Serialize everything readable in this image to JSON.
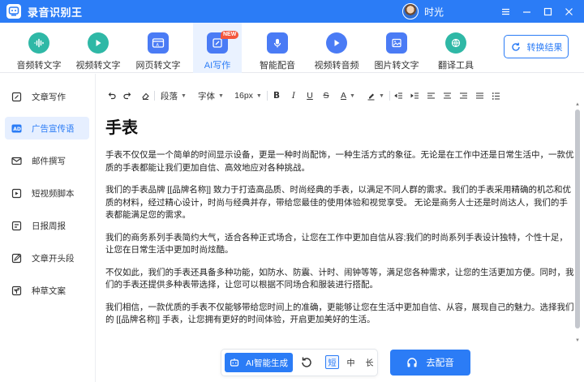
{
  "app": {
    "title": "录音识别王",
    "username": "时光"
  },
  "tools": [
    {
      "label": "音频转文字",
      "icon": "audio-wave-icon",
      "color": "#2fb8a6"
    },
    {
      "label": "视频转文字",
      "icon": "video-play-icon",
      "color": "#2fb8a6"
    },
    {
      "label": "网页转文字",
      "icon": "webpage-icon",
      "color": "#4a7bf5"
    },
    {
      "label": "AI写作",
      "icon": "ai-write-icon",
      "color": "#4a7bf5",
      "badge": "NEW"
    },
    {
      "label": "智能配音",
      "icon": "microphone-icon",
      "color": "#4a7bf5"
    },
    {
      "label": "视频转音频",
      "icon": "video-to-audio-icon",
      "color": "#4a7bf5"
    },
    {
      "label": "图片转文字",
      "icon": "image-text-icon",
      "color": "#4a7bf5"
    },
    {
      "label": "翻译工具",
      "icon": "translate-icon",
      "color": "#2fb8a6"
    }
  ],
  "convert_button": "转换结果",
  "sidebar": {
    "items": [
      {
        "label": "文章写作",
        "icon": "pen-square-icon"
      },
      {
        "label": "广告宣传语",
        "icon": "ad-icon"
      },
      {
        "label": "邮件撰写",
        "icon": "mail-icon"
      },
      {
        "label": "短视频脚本",
        "icon": "video-script-icon"
      },
      {
        "label": "日报周报",
        "icon": "report-icon"
      },
      {
        "label": "文章开头段",
        "icon": "edit-icon"
      },
      {
        "label": "种草文案",
        "icon": "sprout-icon"
      }
    ],
    "active_index": 1
  },
  "format_bar": {
    "paragraph": "段落",
    "font": "字体",
    "size": "16px"
  },
  "document": {
    "title": "手表",
    "paragraphs": [
      "手表不仅仅是一个简单的时间显示设备，更是一种时尚配饰，一种生活方式的象征。无论是在工作中还是日常生活中，一款优质的手表都能让我们更加自信、高效地应对各种挑战。",
      "我们的手表品牌 [[品牌名称]] 致力于打造高品质、时尚经典的手表，以满足不同人群的需求。我们的手表采用精确的机芯和优质的材料，经过精心设计，时尚与经典并存，带给您最佳的使用体验和视觉享受。 无论是商务人士还是时尚达人，我们的手表都能满足您的需求。",
      "我们的商务系列手表简约大气，适合各种正式场合，让您在工作中更加自信从容;我们的时尚系列手表设计独特，个性十足，让您在日常生活中更加时尚炫酷。",
      "不仅如此，我们的手表还具备多种功能，如防水、防震、计时、闹钟等等，满足您各种需求，让您的生活更加方便。同时，我们的手表还提供多种表带选择，让您可以根据不同场合和服装进行搭配。",
      "我们相信，一款优质的手表不仅能够带给您时间上的准确，更能够让您在生活中更加自信、从容，展现自己的魅力。选择我们的 [[品牌名称]] 手表，让您拥有更好的时间体验，开启更加美好的生活。"
    ]
  },
  "bottom": {
    "ai_generate": "AI智能生成",
    "lengths": [
      "短",
      "中",
      "长"
    ],
    "selected_length": "短",
    "dub_button": "去配音"
  },
  "colors": {
    "accent": "#2b7cf6",
    "badge": "#f4573c"
  }
}
